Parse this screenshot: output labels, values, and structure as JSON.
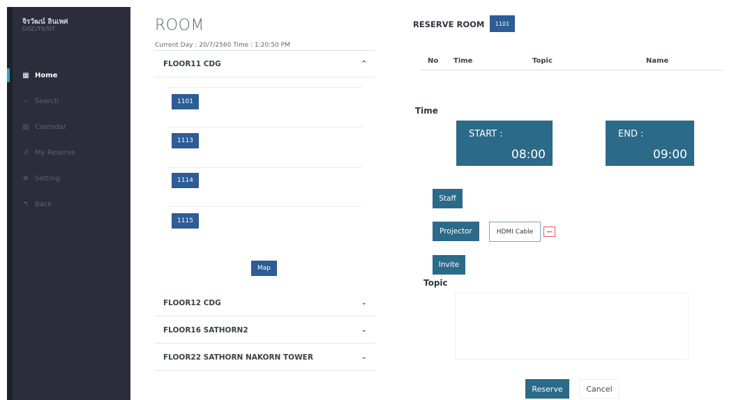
{
  "user": {
    "name": "จิรวัฒน์ ลินเพศ",
    "dept": "GISC/TS/SIT"
  },
  "nav": [
    {
      "label": "Home",
      "icon": "grid-icon"
    },
    {
      "label": "Search",
      "icon": "search-icon"
    },
    {
      "label": "Calendar",
      "icon": "calendar-icon"
    },
    {
      "label": "My Reserve",
      "icon": "history-icon"
    },
    {
      "label": "Setting",
      "icon": "gear-icon"
    },
    {
      "label": "Back",
      "icon": "back-arrow-icon"
    }
  ],
  "main": {
    "title": "ROOM",
    "current_label": "Current  Day :  20/7/2560  Time :  1:20:50 PM",
    "floors": [
      {
        "name": "FLOOR11 CDG",
        "chevron": "^",
        "rooms": [
          "1101",
          "1113",
          "1114",
          "1115"
        ],
        "map_label": "Map"
      },
      {
        "name": "FLOOR12 CDG",
        "chevron": "⌄"
      },
      {
        "name": "FLOOR16 SATHORN2",
        "chevron": "⌄"
      },
      {
        "name": "FLOOR22 SATHORN NAKORN TOWER",
        "chevron": "⌄"
      }
    ]
  },
  "reserve": {
    "title": "RESERVE ROOM",
    "room": "1101",
    "columns": [
      "No",
      "Time",
      "Topic",
      "Name"
    ],
    "time_label": "Time",
    "start_label": "START :",
    "start_value": "08:00",
    "end_label": "END :",
    "end_value": "09:00",
    "staff_label": "Staff",
    "projector_label": "Projector",
    "hdmi_label": "HDMI Cable",
    "remove_symbol": "−",
    "invite_label": "Invite",
    "topic_label": "Topic",
    "reserve_label": "Reserve",
    "cancel_label": "Cancel"
  },
  "colors": {
    "sidebar": "#2b2d3a",
    "accent": "#2b6a88",
    "room_button": "#2d5c96",
    "remove": "#e0595f"
  }
}
